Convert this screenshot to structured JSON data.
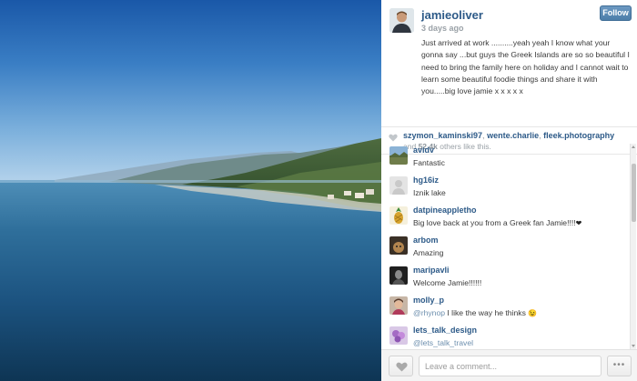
{
  "post": {
    "username": "jamieoliver",
    "time_ago": "3 days ago",
    "follow_label": "Follow",
    "caption": "Just arrived at work ..........yeah yeah I know what your gonna say ...but guys the Greek Islands are so so beautiful I need to bring the family here on holiday and I cannot wait to learn some beautiful foodie things and share it with you.....big love jamie x x x x x"
  },
  "likes": {
    "likers": [
      "szymon_kaminski97",
      "wente.charlie",
      "fleek.photography"
    ],
    "separator": ",",
    "and_text": "and",
    "others_count": "52.4k",
    "others_text": "others like this."
  },
  "comments": [
    {
      "user": "avidv",
      "text": "Fantastic",
      "avatar": "avatar-landscape"
    },
    {
      "user": "hg16iz",
      "text": "Iznik lake",
      "avatar": "avatar-default"
    },
    {
      "user": "datpineappletho",
      "text": "Big love back at you from a Greek fan Jamie!!!!",
      "emoji": "❤",
      "avatar": "avatar-pineapple"
    },
    {
      "user": "arbom",
      "text": "Amazing",
      "avatar": "avatar-dog"
    },
    {
      "user": "maripavli",
      "text": "Welcome Jamie!!!!!!",
      "avatar": "avatar-dark"
    },
    {
      "user": "molly_p",
      "mention": "@rhynop",
      "text": "I like the way he thinks",
      "emoji": "😉",
      "avatar": "avatar-person"
    },
    {
      "user": "lets_talk_design",
      "mention": "@lets_talk_travel",
      "text": "",
      "avatar": "avatar-flowers"
    }
  ],
  "footer": {
    "comment_placeholder": "Leave a comment...",
    "more_label": "•••"
  },
  "colors": {
    "link_blue": "#2d5a88",
    "follow_blue": "#5b8bb6",
    "sky_top": "#1c5fae",
    "sea_dark": "#0f3b5e"
  }
}
